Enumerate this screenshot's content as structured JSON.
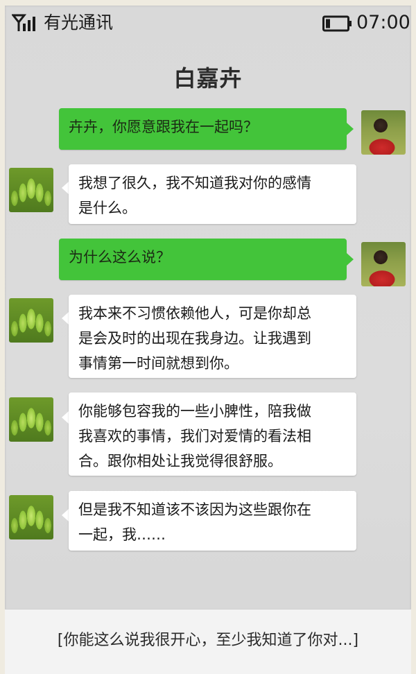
{
  "status_bar": {
    "carrier": "有光通讯",
    "time": "07:00",
    "signal_icon": "signal-icon",
    "battery_icon": "battery-icon"
  },
  "header": {
    "title": "白嘉卉"
  },
  "messages": [
    {
      "side": "right",
      "avatar": "girl",
      "text": "卉卉，你愿意跟我在一起吗？"
    },
    {
      "side": "left",
      "avatar": "plant",
      "lines": [
        "我想了很久，我不知道我对你的感情",
        "是什么。"
      ]
    },
    {
      "side": "right",
      "avatar": "girl",
      "text": "为什么这么说？"
    },
    {
      "side": "left",
      "avatar": "plant",
      "lines": [
        "我本来不习惯依赖他人，可是你却总",
        "是会及时的出现在我身边。让我遇到",
        "事情第一时间就想到你。"
      ]
    },
    {
      "side": "left",
      "avatar": "plant",
      "lines": [
        "你能够包容我的一些小脾性，陪我做",
        "我喜欢的事情，我们对爱情的看法相",
        "合。跟你相处让我觉得很舒服。"
      ]
    },
    {
      "side": "left",
      "avatar": "plant",
      "lines": [
        "但是我不知道该不该因为这些跟你在",
        "一起，我……"
      ]
    }
  ],
  "input_bar": {
    "text": "[你能这么说我很开心，至少我知道了你对...]"
  },
  "colors": {
    "sent_bubble": "#43c43a",
    "received_bubble": "#ffffff",
    "background": "#d9d9d9"
  }
}
